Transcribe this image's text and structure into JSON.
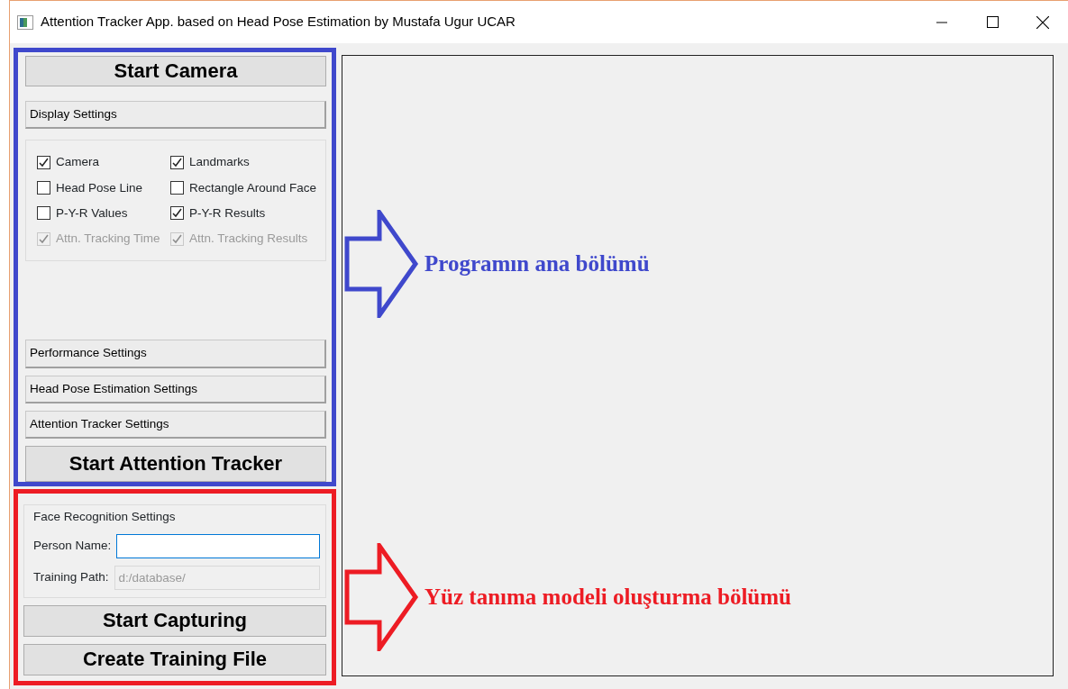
{
  "window": {
    "title": "Attention Tracker App. based on Head Pose Estimation by Mustafa Ugur UCAR"
  },
  "main_panel": {
    "start_button": "Start Camera",
    "display_section": "Display Settings",
    "collapsed_sections": [
      "Performance Settings",
      "Head Pose Estimation Settings",
      "Attention Tracker Settings"
    ],
    "options": [
      {
        "label": "Camera",
        "checked": true,
        "disabled": false
      },
      {
        "label": "Landmarks",
        "checked": true,
        "disabled": false
      },
      {
        "label": "Head Pose Line",
        "checked": false,
        "disabled": false
      },
      {
        "label": "Rectangle Around Face",
        "checked": false,
        "disabled": false
      },
      {
        "label": "P-Y-R Values",
        "checked": false,
        "disabled": false
      },
      {
        "label": "P-Y-R Results",
        "checked": true,
        "disabled": false
      },
      {
        "label": "Attn. Tracking Time",
        "checked": true,
        "disabled": true
      },
      {
        "label": "Attn. Tracking Results",
        "checked": true,
        "disabled": true
      }
    ],
    "tracker_button": "Start Attention Tracker"
  },
  "face_recognition": {
    "title": "Face Recognition Settings",
    "fields": [
      {
        "label": "Person Name:",
        "focused": true,
        "disabled": false
      },
      {
        "label": "Training Path:",
        "value": "d:/database/",
        "focused": false,
        "disabled": true
      }
    ],
    "buttons": [
      "Start Capturing",
      "Create Training File"
    ]
  },
  "annotations": [
    {
      "text": "Programın ana bölümü",
      "color": "#3f48cc"
    },
    {
      "text": "Yüz tanıma modeli oluşturma bölümü",
      "color": "#ed1c24"
    }
  ]
}
